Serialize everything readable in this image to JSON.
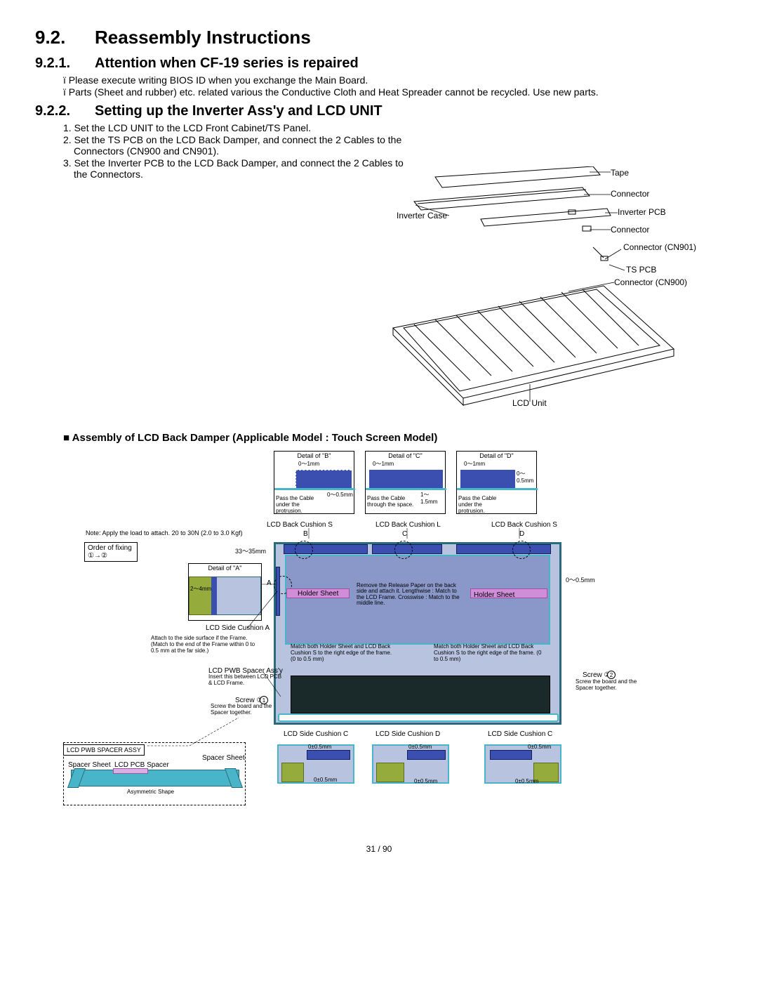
{
  "section": {
    "num": "9.2.",
    "title": "Reassembly Instructions"
  },
  "sub1": {
    "num": "9.2.1.",
    "title": "Attention when CF-19 series is repaired",
    "bullet1": "ï Please execute writing BIOS ID when you exchange the Main Board.",
    "bullet2": "ï Parts (Sheet and rubber) etc. related various the Conductive Cloth and Heat Spreader cannot be recycled. Use new parts."
  },
  "sub2": {
    "num": "9.2.2.",
    "title": "Setting up the Inverter Ass'y and LCD UNIT",
    "step1": "1. Set the LCD UNIT to the LCD Front Cabinet/TS Panel.",
    "step2": "2. Set the TS PCB on the LCD Back Damper, and connect the 2 Cables to the Connectors (CN900 and CN901).",
    "step3": "3. Set the Inverter PCB to the LCD Back Damper, and connect the 2 Cables to the Connectors."
  },
  "fig1_labels": {
    "tape": "Tape",
    "connector1": "Connector",
    "inverter_case": "Inverter Case",
    "inverter_pcb": "Inverter PCB",
    "connector2": "Connector",
    "connector_cn901": "Connector (CN901)",
    "ts_pcb": "TS PCB",
    "connector_cn900": "Connector (CN900)",
    "lcd_unit": "LCD Unit"
  },
  "assembly_heading": "■ Assembly of LCD Back Damper (Applicable Model : Touch Screen Model)",
  "fig2": {
    "detail_b": "Detail of \"B\"",
    "detail_c": "Detail of \"C\"",
    "detail_d": "Detail of \"D\"",
    "detail_a": "Detail of \"A\"",
    "dim_0_1mm": "0～1mm",
    "dim_0_05mm": "0～0.5mm",
    "dim_1_15mm": "1～1.5mm",
    "dim_2_4mm": "2～4mm",
    "dim_33_35mm": "33～35mm",
    "dim_0pm05": "0±0.5mm",
    "pass_cable_under": "Pass the Cable under the protrusion.",
    "pass_cable_through": "Pass the Cable through the space.",
    "lcd_back_cushion_s": "LCD Back Cushion S",
    "lcd_back_cushion_l": "LCD Back Cushion L",
    "note_load": "Note: Apply the load to attach. 20 to 30N (2.0 to 3.0 Kgf)",
    "order_fixing": "Order of fixing",
    "order_fixing_nums": "①→②",
    "lcd_side_cushion_a": "LCD Side Cushion A",
    "attach_side": "Attach to the side surface if the Frame. (Match to the end of the Frame within 0 to 0.5 mm at the far side.)",
    "lcd_pwb_spacer_assy": "LCD PWB Spacer Ass'y",
    "insert_between": "Insert this between LCD PCB & LCD Frame.",
    "screw1": "Screw ①",
    "screw1_note": "Screw the board and the Spacer together.",
    "screw2": "Screw ②",
    "screw2_note": "Screw the board and the Spacer together.",
    "holder_sheet": "Holder Sheet",
    "remove_release": "Remove the Release Paper on the back side and attach it. Lengthwise : Match to the LCD Frame. Crosswise : Match to the middle line.",
    "match_both_left": "Match both Holder Sheet and LCD Back Cushion S to the right edge of the frame. (0 to 0.5 mm)",
    "match_both_right": "Match both Holder Sheet and LCD Back Cushion S to the right edge of the frame. (0 to 0.5 mm)",
    "lcd_side_cushion_c": "LCD Side Cushion C",
    "lcd_side_cushion_d": "LCD Side Cushion D",
    "lcd_pwb_spacer_assy_box": "LCD PWB SPACER ASSY",
    "spacer_sheet": "Spacer Sheet",
    "lcd_pcb_spacer": "LCD PCB Spacer",
    "asymmetric_shape": "Asymmetric Shape",
    "letter_a": "A",
    "letter_b": "B",
    "letter_c": "C",
    "letter_d": "D"
  },
  "page_number": "31 / 90"
}
